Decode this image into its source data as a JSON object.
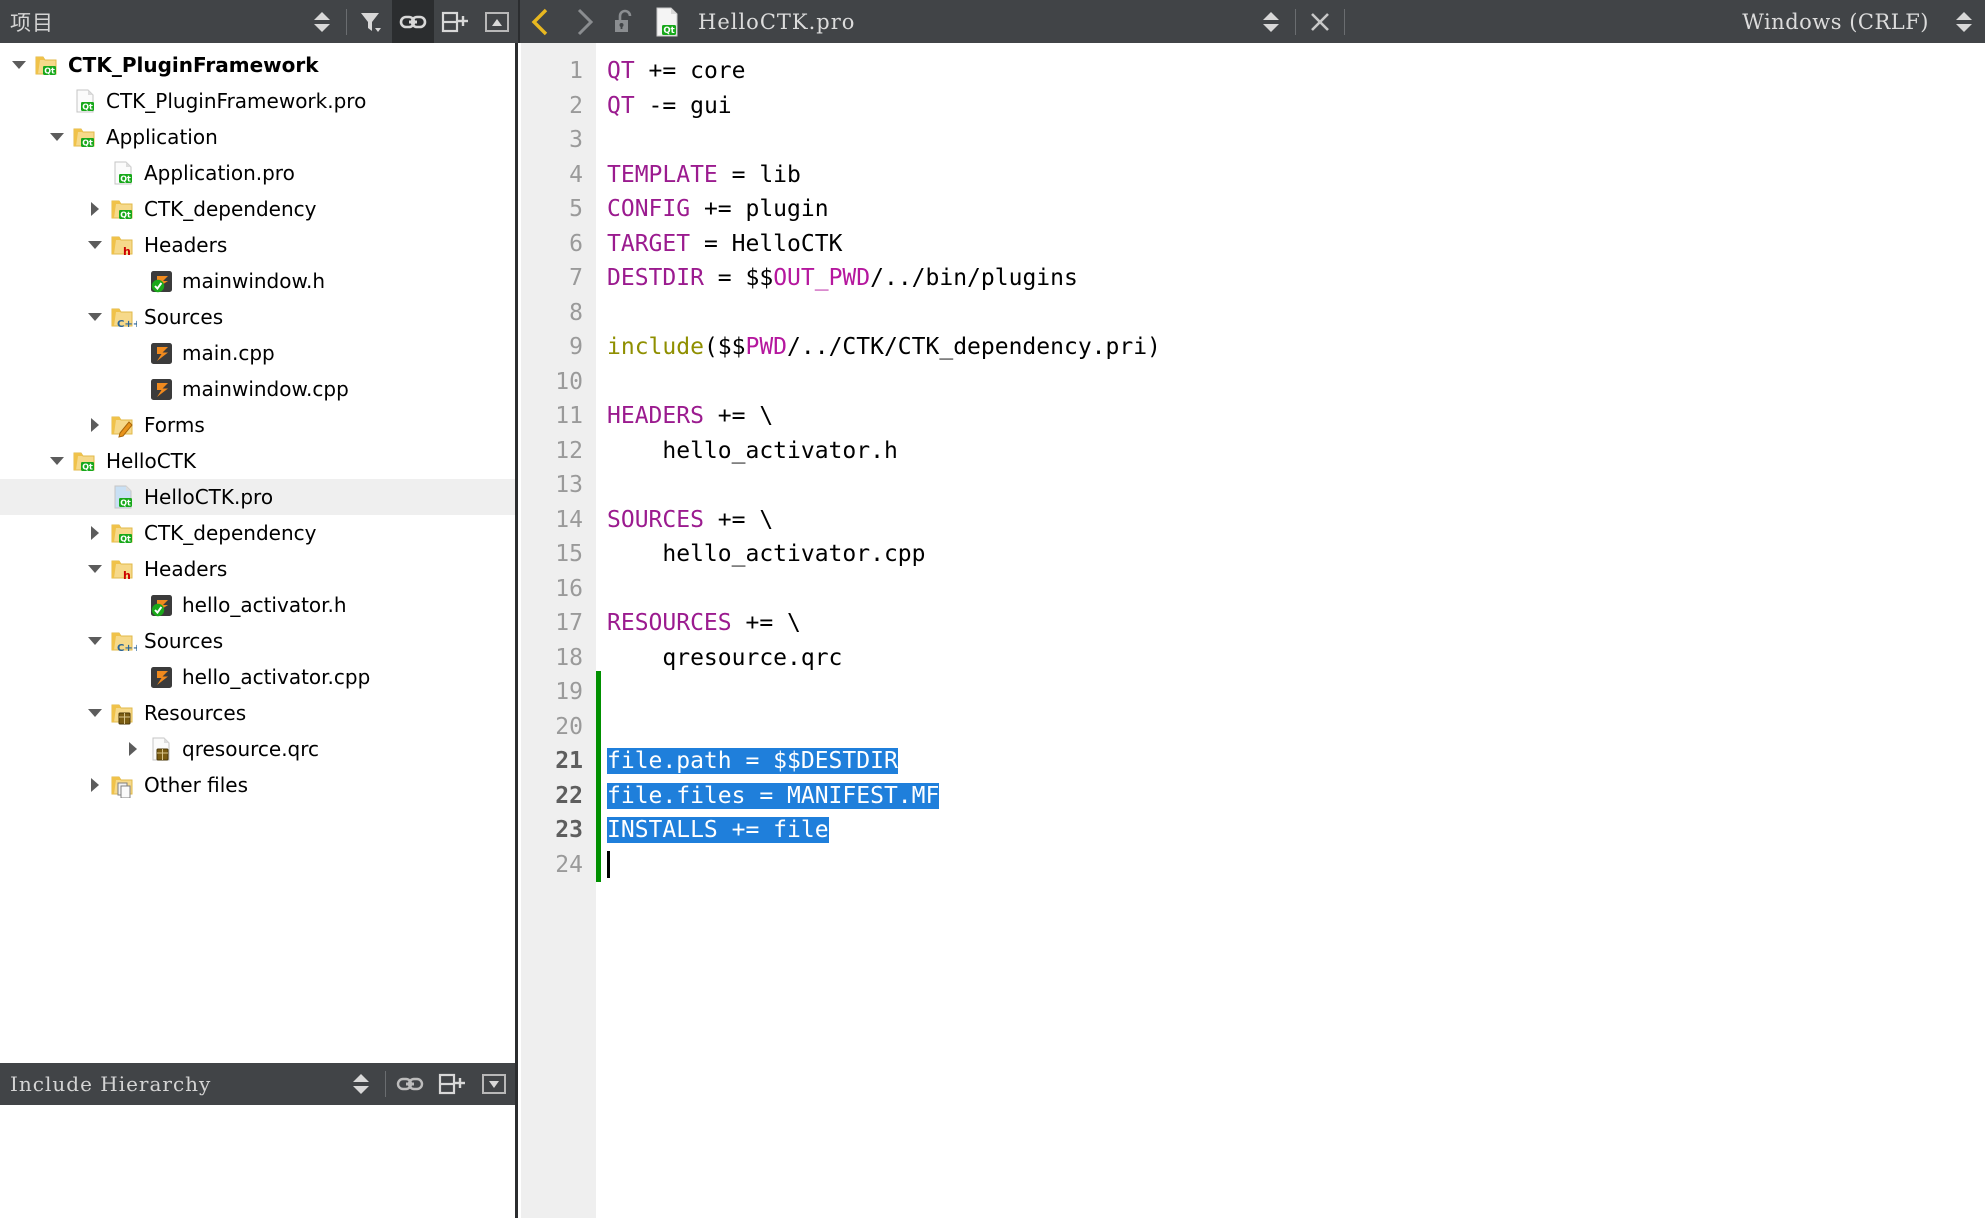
{
  "window": {
    "eol_label": "Windows (CRLF)",
    "accent_selection": "#1f7fdb",
    "toolbar_bg": "#414447",
    "changebar_color": "#009000"
  },
  "left_panel": {
    "title": "项目",
    "toolbar_buttons": [
      {
        "name": "sync-updown-icon",
        "label": "Synchronize"
      },
      {
        "name": "filter-icon",
        "label": "Filter Tree"
      },
      {
        "name": "link-icon",
        "label": "Synchronize with Editor",
        "pressed": true
      },
      {
        "name": "split-add-icon",
        "label": "Add Split"
      },
      {
        "name": "minimize-icon",
        "label": "Close Sidebar"
      }
    ]
  },
  "editor_toolbar": {
    "back_label": "Go Back",
    "forward_label": "Go Forward",
    "lock_label": "Make Writable",
    "filename": "HelloCTK.pro",
    "dropdown_label": "Open Documents",
    "close_label": "Close Document"
  },
  "bottom_panel": {
    "title": "Include Hierarchy",
    "toolbar_buttons": [
      {
        "name": "sync-updown-icon",
        "label": "Synchronize"
      },
      {
        "name": "link-icon",
        "label": "Synchronize with Editor"
      },
      {
        "name": "split-add-icon",
        "label": "Add Split"
      },
      {
        "name": "collapse-icon",
        "label": "Collapse"
      }
    ]
  },
  "tree": [
    {
      "label": "CTK_PluginFramework",
      "depth": 0,
      "arrow": "down",
      "icon": "folder-qt",
      "bold": true,
      "selected": false
    },
    {
      "label": "CTK_PluginFramework.pro",
      "depth": 1,
      "arrow": "none",
      "icon": "file-qt",
      "bold": false,
      "selected": false
    },
    {
      "label": "Application",
      "depth": 1,
      "arrow": "down",
      "icon": "folder-qt",
      "bold": false,
      "selected": false
    },
    {
      "label": "Application.pro",
      "depth": 2,
      "arrow": "none",
      "icon": "file-qt",
      "bold": false,
      "selected": false
    },
    {
      "label": "CTK_dependency",
      "depth": 2,
      "arrow": "right",
      "icon": "folder-qt",
      "bold": false,
      "selected": false
    },
    {
      "label": "Headers",
      "depth": 2,
      "arrow": "down",
      "icon": "folder-h",
      "bold": false,
      "selected": false
    },
    {
      "label": "mainwindow.h",
      "depth": 3,
      "arrow": "none",
      "icon": "file-h",
      "bold": false,
      "selected": false
    },
    {
      "label": "Sources",
      "depth": 2,
      "arrow": "down",
      "icon": "folder-cpp",
      "bold": false,
      "selected": false
    },
    {
      "label": "main.cpp",
      "depth": 3,
      "arrow": "none",
      "icon": "file-cpp",
      "bold": false,
      "selected": false
    },
    {
      "label": "mainwindow.cpp",
      "depth": 3,
      "arrow": "none",
      "icon": "file-cpp",
      "bold": false,
      "selected": false
    },
    {
      "label": "Forms",
      "depth": 2,
      "arrow": "right",
      "icon": "folder-form",
      "bold": false,
      "selected": false
    },
    {
      "label": "HelloCTK",
      "depth": 1,
      "arrow": "down",
      "icon": "folder-qt",
      "bold": false,
      "selected": false
    },
    {
      "label": "HelloCTK.pro",
      "depth": 2,
      "arrow": "none",
      "icon": "file-qt-sel",
      "bold": false,
      "selected": true
    },
    {
      "label": "CTK_dependency",
      "depth": 2,
      "arrow": "right",
      "icon": "folder-qt",
      "bold": false,
      "selected": false
    },
    {
      "label": "Headers",
      "depth": 2,
      "arrow": "down",
      "icon": "folder-h",
      "bold": false,
      "selected": false
    },
    {
      "label": "hello_activator.h",
      "depth": 3,
      "arrow": "none",
      "icon": "file-h",
      "bold": false,
      "selected": false
    },
    {
      "label": "Sources",
      "depth": 2,
      "arrow": "down",
      "icon": "folder-cpp",
      "bold": false,
      "selected": false
    },
    {
      "label": "hello_activator.cpp",
      "depth": 3,
      "arrow": "none",
      "icon": "file-cpp",
      "bold": false,
      "selected": false
    },
    {
      "label": "Resources",
      "depth": 2,
      "arrow": "down",
      "icon": "folder-qrc",
      "bold": false,
      "selected": false
    },
    {
      "label": "qresource.qrc",
      "depth": 3,
      "arrow": "right",
      "icon": "file-qrc",
      "bold": false,
      "selected": false
    },
    {
      "label": "Other files",
      "depth": 2,
      "arrow": "right",
      "icon": "folder-other",
      "bold": false,
      "selected": false
    }
  ],
  "code": {
    "language": "qmake",
    "total_lines": 24,
    "selection_lines": [
      21,
      22,
      23
    ],
    "changed_lines": [
      19,
      20,
      21,
      22,
      23,
      24
    ],
    "cursor_line": 24,
    "lines": [
      {
        "n": 1,
        "tokens": [
          {
            "t": "QT",
            "c": "kw"
          },
          {
            "t": " += core",
            "c": "plain"
          }
        ]
      },
      {
        "n": 2,
        "tokens": [
          {
            "t": "QT",
            "c": "kw"
          },
          {
            "t": " -= gui",
            "c": "plain"
          }
        ]
      },
      {
        "n": 3,
        "tokens": []
      },
      {
        "n": 4,
        "tokens": [
          {
            "t": "TEMPLATE",
            "c": "kw"
          },
          {
            "t": " = lib",
            "c": "plain"
          }
        ]
      },
      {
        "n": 5,
        "tokens": [
          {
            "t": "CONFIG",
            "c": "kw"
          },
          {
            "t": " += plugin",
            "c": "plain"
          }
        ]
      },
      {
        "n": 6,
        "tokens": [
          {
            "t": "TARGET",
            "c": "kw"
          },
          {
            "t": " = HelloCTK",
            "c": "plain"
          }
        ]
      },
      {
        "n": 7,
        "tokens": [
          {
            "t": "DESTDIR",
            "c": "kw"
          },
          {
            "t": " = $$",
            "c": "plain"
          },
          {
            "t": "OUT_PWD",
            "c": "var"
          },
          {
            "t": "/../bin/plugins",
            "c": "plain"
          }
        ]
      },
      {
        "n": 8,
        "tokens": []
      },
      {
        "n": 9,
        "tokens": [
          {
            "t": "include",
            "c": "func"
          },
          {
            "t": "($$",
            "c": "plain"
          },
          {
            "t": "PWD",
            "c": "var"
          },
          {
            "t": "/../CTK/CTK_dependency.pri)",
            "c": "plain"
          }
        ]
      },
      {
        "n": 10,
        "tokens": []
      },
      {
        "n": 11,
        "tokens": [
          {
            "t": "HEADERS",
            "c": "kw"
          },
          {
            "t": " += \\",
            "c": "plain"
          }
        ]
      },
      {
        "n": 12,
        "tokens": [
          {
            "t": "    hello_activator.h",
            "c": "plain"
          }
        ]
      },
      {
        "n": 13,
        "tokens": []
      },
      {
        "n": 14,
        "tokens": [
          {
            "t": "SOURCES",
            "c": "kw"
          },
          {
            "t": " += \\",
            "c": "plain"
          }
        ]
      },
      {
        "n": 15,
        "tokens": [
          {
            "t": "    hello_activator.cpp",
            "c": "plain"
          }
        ]
      },
      {
        "n": 16,
        "tokens": []
      },
      {
        "n": 17,
        "tokens": [
          {
            "t": "RESOURCES",
            "c": "kw"
          },
          {
            "t": " += \\",
            "c": "plain"
          }
        ]
      },
      {
        "n": 18,
        "tokens": [
          {
            "t": "    qresource.qrc",
            "c": "plain"
          }
        ]
      },
      {
        "n": 19,
        "tokens": []
      },
      {
        "n": 20,
        "tokens": []
      },
      {
        "n": 21,
        "tokens": [
          {
            "t": "file.path = $$DESTDIR",
            "c": "sel"
          }
        ]
      },
      {
        "n": 22,
        "tokens": [
          {
            "t": "file.files = MANIFEST.MF",
            "c": "sel"
          }
        ]
      },
      {
        "n": 23,
        "tokens": [
          {
            "t": "INSTALLS += file",
            "c": "sel"
          }
        ]
      },
      {
        "n": 24,
        "tokens": []
      }
    ]
  }
}
